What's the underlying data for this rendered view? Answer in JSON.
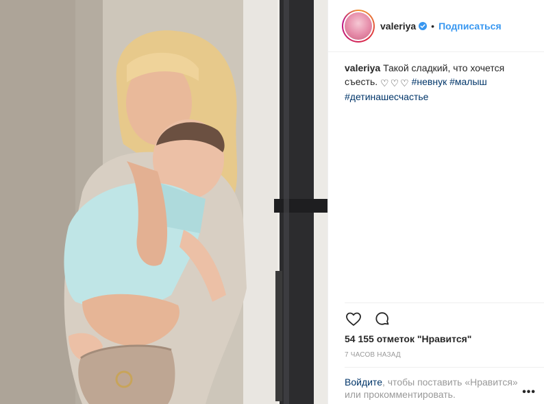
{
  "post": {
    "image_alt": "photo",
    "header": {
      "username": "valeriya",
      "separator": "•",
      "follow_label": "Подписаться"
    },
    "caption": {
      "username": "valeriya",
      "text": "Такой сладкий, что хочется съесть.",
      "hearts": [
        "♡",
        "♡",
        "♡"
      ],
      "hashtags": [
        "#невнук",
        "#малыш",
        "#детинашесчастье"
      ]
    },
    "actions": {
      "like_icon": "heart-icon",
      "comment_icon": "comment-icon"
    },
    "likes_text": "54 155 отметок \"Нравится\"",
    "timestamp": "7 ЧАСОВ НАЗАД",
    "login_prompt": {
      "link": "Войдите",
      "rest": ", чтобы поставить «Нравится» или прокомментировать."
    },
    "more_icon": "•••"
  },
  "colors": {
    "link_blue": "#3897f0",
    "hashtag_navy": "#003569",
    "muted_gray": "#999999",
    "text": "#262626",
    "border": "#efefef"
  }
}
